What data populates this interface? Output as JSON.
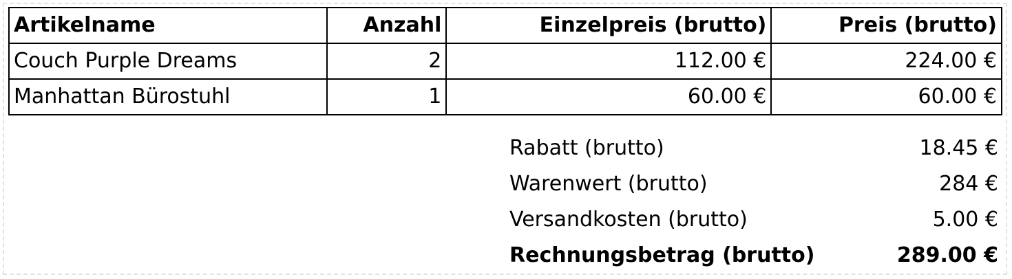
{
  "table": {
    "headers": {
      "name": "Artikelname",
      "quantity": "Anzahl",
      "unit_price": "Einzelpreis (brutto)",
      "total_price": "Preis (brutto)"
    },
    "rows": [
      {
        "name": "Couch Purple Dreams",
        "quantity": "2",
        "unit_price": "112.00 €",
        "total_price": "224.00 €"
      },
      {
        "name": "Manhattan Bürostuhl",
        "quantity": "1",
        "unit_price": "60.00 €",
        "total_price": "60.00 €"
      }
    ]
  },
  "summary": {
    "discount": {
      "label": "Rabatt (brutto)",
      "value": "18.45 €"
    },
    "goods_value": {
      "label": "Warenwert (brutto)",
      "value": "284 €"
    },
    "shipping": {
      "label": "Versandkosten (brutto)",
      "value": "5.00 €"
    },
    "invoice_total": {
      "label": "Rechnungsbetrag (brutto)",
      "value": "289.00 €"
    }
  }
}
